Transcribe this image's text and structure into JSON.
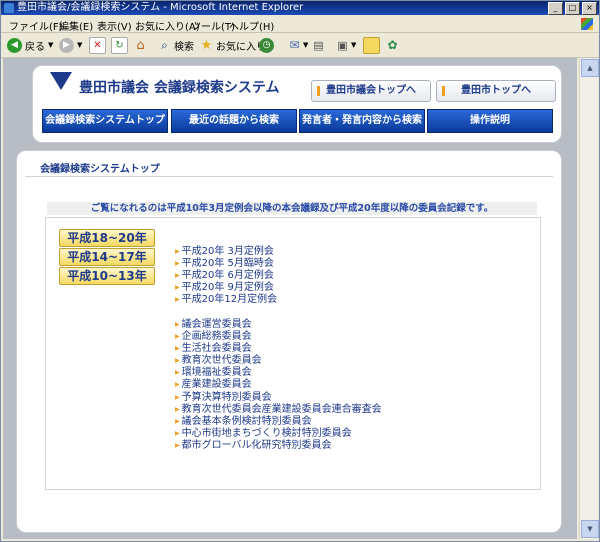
{
  "window": {
    "title": "豊田市議会/会議録検索システム - Microsoft Internet Explorer",
    "controls": [
      "_",
      "□",
      "×"
    ]
  },
  "menu": [
    "ファイル(F)",
    "編集(E)",
    "表示(V)",
    "お気に入り(A)",
    "ツール(T)",
    "ヘルプ(H)"
  ],
  "toolbar": {
    "back_label": "戻る",
    "search_label": "検索",
    "favorites_label": "お気に入り"
  },
  "site": {
    "name": "豊田市議会 会議録検索システム",
    "top_links": [
      "豊田市議会トップへ",
      "豊田市トップへ"
    ],
    "nav": [
      "会議録検索システムトップ",
      "最近の話題から検索",
      "発言者・発言内容から検索",
      "操作説明"
    ]
  },
  "page": {
    "section_title": "会議録検索システムトップ",
    "notice": "ご覧になれるのは平成10年3月定例会以降の本会議録及び平成20年度以降の委員会記録です。",
    "eras": [
      "平成18~20年",
      "平成14~17年",
      "平成10~13年"
    ],
    "sessions": [
      "平成20年 3月定例会",
      "平成20年 5月臨時会",
      "平成20年 6月定例会",
      "平成20年 9月定例会",
      "平成20年12月定例会"
    ],
    "committees": [
      "議会運営委員会",
      "企画総務委員会",
      "生活社会委員会",
      "教育次世代委員会",
      "環境福祉委員会",
      "産業建設委員会",
      "予算決算特別委員会",
      "教育次世代委員会産業建設委員会連合審査会",
      "議会基本条例検討特別委員会",
      "中心市街地まちづくり検討特別委員会",
      "都市グローバル化研究特別委員会"
    ]
  },
  "colors": {
    "title_bar": "#0a246a",
    "brand_navy": "#1e3a8a",
    "nav_blue": "#1a4fb8",
    "bullet_orange": "#f0a020"
  }
}
